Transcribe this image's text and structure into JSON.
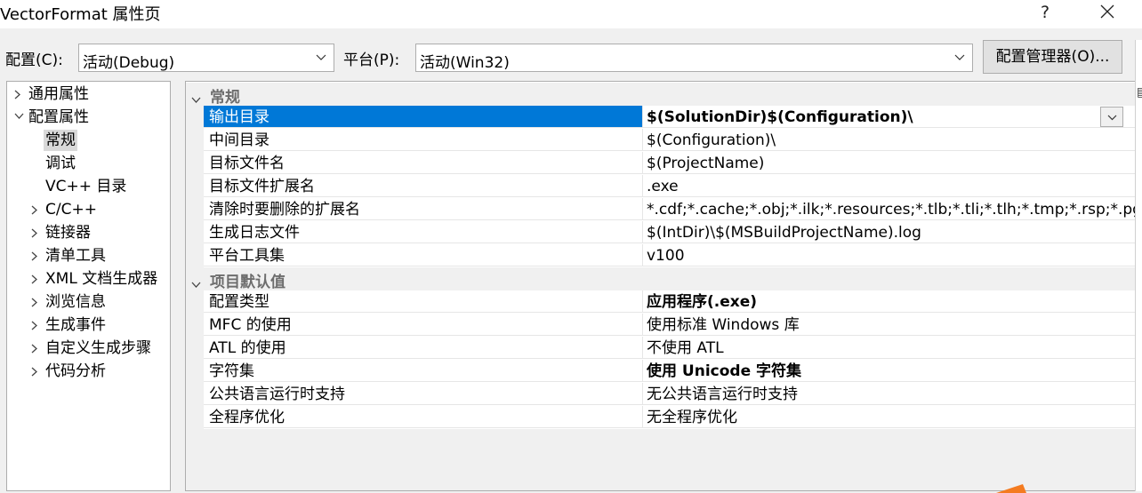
{
  "window": {
    "title": "VectorFormat 属性页",
    "help": "?"
  },
  "config_bar": {
    "config_label": "配置(C):",
    "config_value": "活动(Debug)",
    "platform_label": "平台(P):",
    "platform_value": "活动(Win32)",
    "manager_button": "配置管理器(O)..."
  },
  "tree": {
    "items": [
      {
        "label": "通用属性",
        "expander": "collapsed"
      },
      {
        "label": "配置属性",
        "expander": "expanded"
      },
      {
        "label": "常规",
        "expander": "none",
        "selected": true
      },
      {
        "label": "调试",
        "expander": "none"
      },
      {
        "label": "VC++ 目录",
        "expander": "none"
      },
      {
        "label": "C/C++",
        "expander": "collapsed"
      },
      {
        "label": "链接器",
        "expander": "collapsed"
      },
      {
        "label": "清单工具",
        "expander": "collapsed"
      },
      {
        "label": "XML 文档生成器",
        "expander": "collapsed"
      },
      {
        "label": "浏览信息",
        "expander": "collapsed"
      },
      {
        "label": "生成事件",
        "expander": "collapsed"
      },
      {
        "label": "自定义生成步骤",
        "expander": "collapsed"
      },
      {
        "label": "代码分析",
        "expander": "collapsed"
      }
    ]
  },
  "grid": {
    "categories": [
      {
        "label": "常规",
        "rows": [
          {
            "name": "输出目录",
            "value": "$(SolutionDir)$(Configuration)\\",
            "bold": true,
            "selected": true
          },
          {
            "name": "中间目录",
            "value": "$(Configuration)\\"
          },
          {
            "name": "目标文件名",
            "value": "$(ProjectName)"
          },
          {
            "name": "目标文件扩展名",
            "value": ".exe"
          },
          {
            "name": "清除时要删除的扩展名",
            "value": "*.cdf;*.cache;*.obj;*.ilk;*.resources;*.tlb;*.tli;*.tlh;*.tmp;*.rsp;*.pgc"
          },
          {
            "name": "生成日志文件",
            "value": "$(IntDir)\\$(MSBuildProjectName).log"
          },
          {
            "name": "平台工具集",
            "value": "v100"
          }
        ]
      },
      {
        "label": "项目默认值",
        "rows": [
          {
            "name": "配置类型",
            "value": "应用程序(.exe)",
            "bold": true
          },
          {
            "name": "MFC 的使用",
            "value": "使用标准 Windows 库"
          },
          {
            "name": "ATL 的使用",
            "value": "不使用 ATL"
          },
          {
            "name": "字符集",
            "value": "使用 Unicode 字符集",
            "bold": true
          },
          {
            "name": "公共语言运行时支持",
            "value": "无公共语言运行时支持"
          },
          {
            "name": "全程序优化",
            "value": "无全程序优化"
          }
        ]
      }
    ]
  },
  "colors": {
    "selection": "#0078d7",
    "accent_orange": "#f47b20"
  },
  "icons": {
    "close": "close-icon",
    "dropdown": "chevron-down-icon",
    "tree_collapsed": "chevron-right-icon",
    "tree_expanded": "chevron-down-icon"
  }
}
